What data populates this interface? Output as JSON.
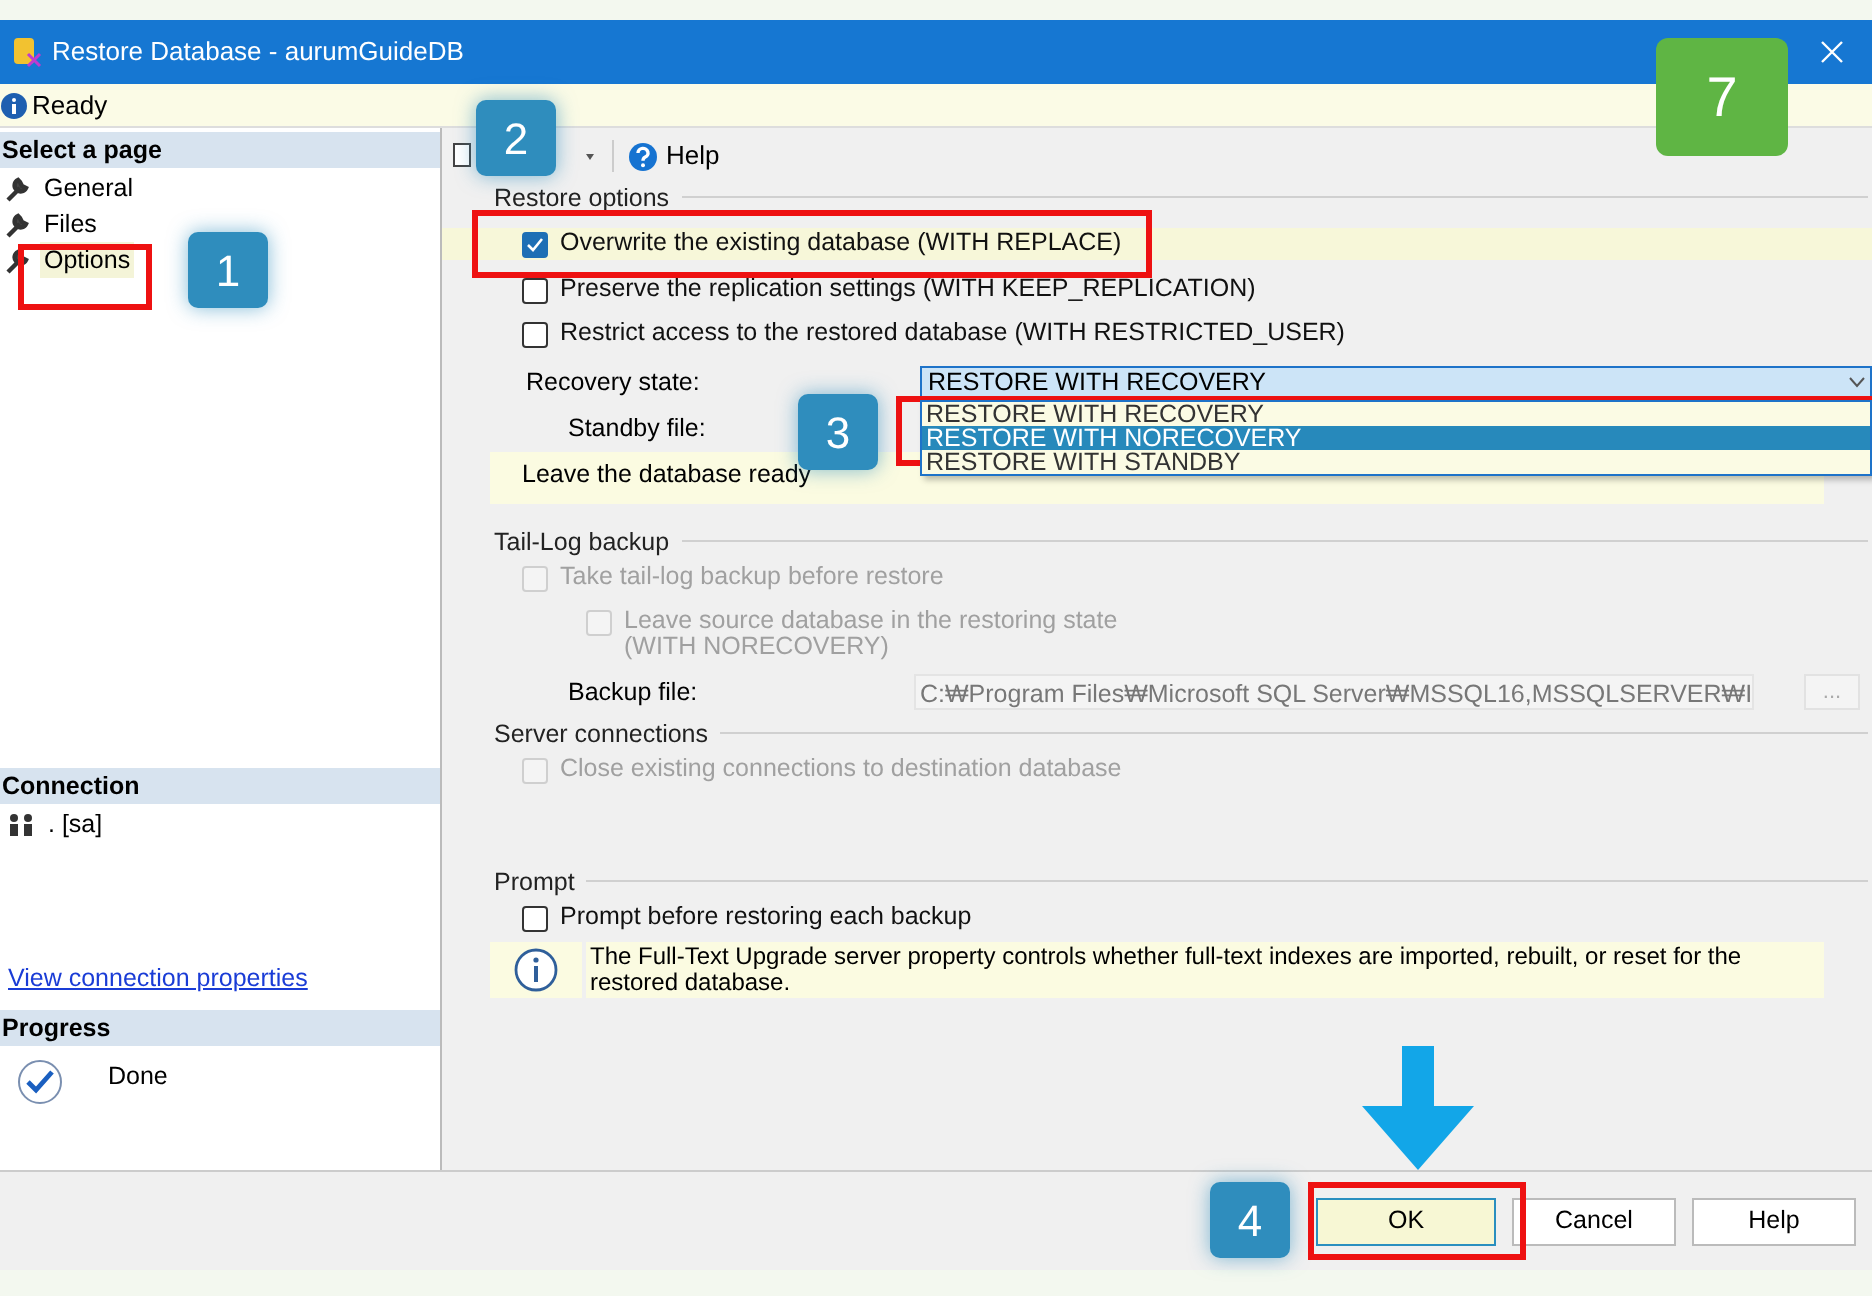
{
  "window": {
    "title": "Restore Database - aurumGuideDB"
  },
  "status": {
    "text": "Ready"
  },
  "sidebar": {
    "header": "Select a page",
    "items": [
      {
        "label": "General",
        "selected": false
      },
      {
        "label": "Files",
        "selected": false
      },
      {
        "label": "Options",
        "selected": true
      }
    ]
  },
  "connection": {
    "header": "Connection",
    "server": ". [sa]",
    "link": "View connection properties"
  },
  "progress": {
    "header": "Progress",
    "status": "Done"
  },
  "toolbar": {
    "help": "Help"
  },
  "restore_options": {
    "title": "Restore options",
    "options": [
      {
        "label": "Overwrite the existing database (WITH REPLACE)",
        "checked": true
      },
      {
        "label": "Preserve the replication settings (WITH KEEP_REPLICATION)",
        "checked": false
      },
      {
        "label": "Restrict access to the restored database (WITH RESTRICTED_USER)",
        "checked": false
      }
    ],
    "recovery_label": "Recovery state:",
    "recovery_value": "RESTORE WITH RECOVERY",
    "recovery_choices": [
      {
        "label": "RESTORE WITH RECOVERY",
        "selected": false
      },
      {
        "label": "RESTORE WITH NORECOVERY",
        "selected": true
      },
      {
        "label": "RESTORE WITH STANDBY",
        "selected": false
      }
    ],
    "standby_label": "Standby file:",
    "description": "Leave the database ready"
  },
  "tail_log": {
    "title": "Tail-Log backup",
    "options": [
      {
        "label": "Take tail-log backup before restore",
        "checked": false,
        "disabled": true
      },
      {
        "label": "Leave source database in the restoring state\n(WITH NORECOVERY)",
        "checked": false,
        "disabled": true
      }
    ],
    "backup_label": "Backup file:",
    "backup_value": "C:₩Program Files₩Microsoft SQL Server₩MSSQL16,MSSQLSERVER₩I",
    "browse": "..."
  },
  "server_connections": {
    "title": "Server connections",
    "options": [
      {
        "label": "Close existing connections to destination database",
        "checked": false,
        "disabled": true
      }
    ]
  },
  "prompt": {
    "title": "Prompt",
    "options": [
      {
        "label": "Prompt before restoring each backup",
        "checked": false
      }
    ],
    "info": "The Full-Text Upgrade server property controls whether full-text indexes are imported, rebuilt, or reset for the restored database."
  },
  "buttons": [
    "OK",
    "Cancel",
    "Help"
  ],
  "annotations": {
    "badges": [
      "1",
      "2",
      "3",
      "4",
      "7"
    ]
  }
}
